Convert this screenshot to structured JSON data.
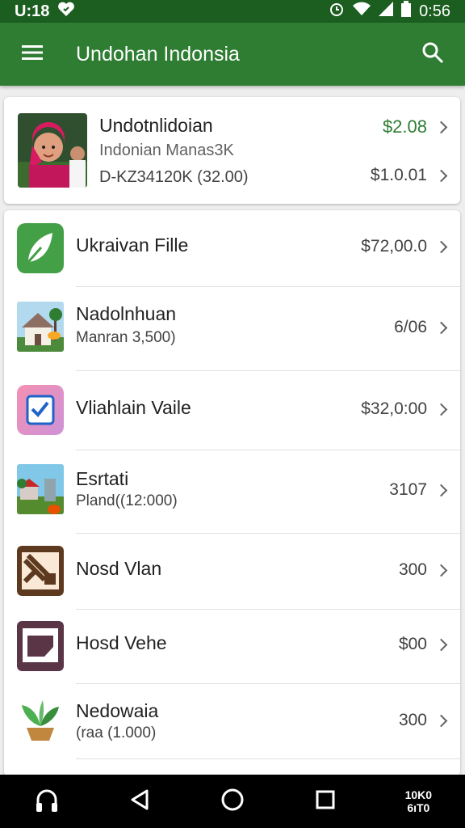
{
  "status_bar": {
    "time_left": "U:18",
    "time_right": "0:56"
  },
  "app_bar": {
    "title": "Undohan Indonsia",
    "menu_icon": "hamburger-menu-icon",
    "search_icon": "search-icon"
  },
  "featured": {
    "title": "Undotnlidoian",
    "subtitle": "Indonian Manas3K",
    "detail": "D-KZ34120K (32.00)",
    "price_top": "$2.08",
    "price_bottom": "$1.0.01",
    "accent_color": "#2e7d32"
  },
  "items": [
    {
      "title": "Ukraivan Fille",
      "subtitle": "",
      "price": "$72,00.0",
      "icon": "leaf-icon"
    },
    {
      "title": "Nadolnhuan",
      "subtitle": "Manran 3,500)",
      "price": "6/06",
      "icon": "house-icon"
    },
    {
      "title": "Vliahlain Vaile",
      "subtitle": "",
      "price": "$32,0:00",
      "icon": "checkbox-icon"
    },
    {
      "title": "Esrtati",
      "subtitle": "Pland((12:000)",
      "price": "3107",
      "icon": "village-icon"
    },
    {
      "title": "Nosd Vlan",
      "subtitle": "",
      "price": "300",
      "icon": "tools-icon"
    },
    {
      "title": "Hosd Vehe",
      "subtitle": "",
      "price": "$00",
      "icon": "monitor-icon"
    },
    {
      "title": "Nedowaia",
      "subtitle": "(raa (1.000)",
      "price": "300",
      "icon": "plant-icon"
    }
  ],
  "nav_bar": {
    "extra_text_top": "10K0",
    "extra_text_bottom": "6ıT0"
  },
  "colors": {
    "status_bar": "#1b5e20",
    "app_bar": "#2e7d32",
    "background": "#eeeeee"
  }
}
